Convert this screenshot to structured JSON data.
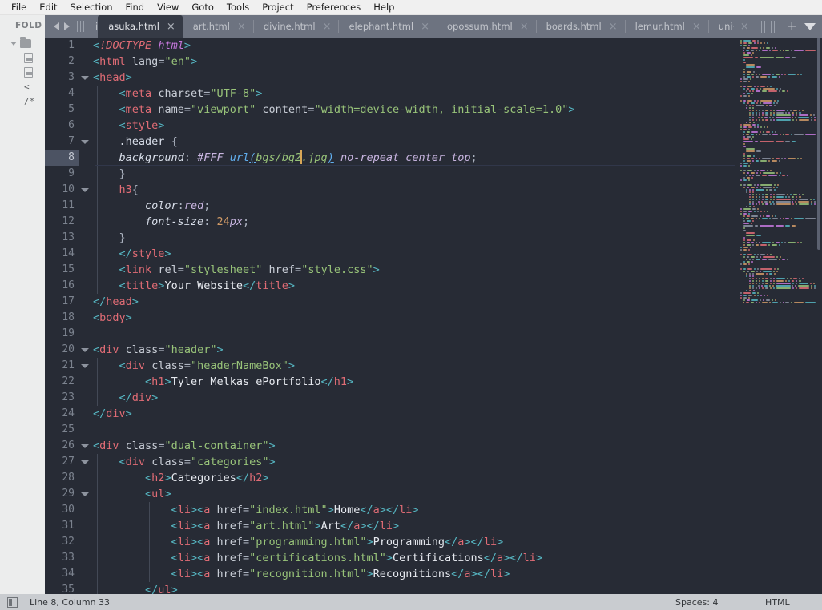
{
  "menu": {
    "items": [
      "File",
      "Edit",
      "Selection",
      "Find",
      "View",
      "Goto",
      "Tools",
      "Project",
      "Preferences",
      "Help"
    ]
  },
  "sidebar": {
    "title": "FOLD",
    "tree": [
      {
        "type": "folder",
        "label": ""
      },
      {
        "type": "file",
        "label": ""
      },
      {
        "type": "file",
        "label": ""
      },
      {
        "type": "text",
        "label": "<"
      },
      {
        "type": "text",
        "label": "/*"
      }
    ]
  },
  "tabbar": {
    "nav_prev": "◀",
    "nav_next": "▶",
    "close_glyph": "×",
    "new_tab": "+",
    "tabs": [
      {
        "label": "i",
        "active": false,
        "clipped": true
      },
      {
        "label": "asuka.html",
        "active": true,
        "clipped": false
      },
      {
        "label": "art.html",
        "active": false,
        "clipped": false
      },
      {
        "label": "divine.html",
        "active": false,
        "clipped": false
      },
      {
        "label": "elephant.html",
        "active": false,
        "clipped": false
      },
      {
        "label": "opossum.html",
        "active": false,
        "clipped": false
      },
      {
        "label": "boards.html",
        "active": false,
        "clipped": false
      },
      {
        "label": "lemur.html",
        "active": false,
        "clipped": false
      },
      {
        "label": "unitone.html",
        "active": false,
        "clipped": false
      }
    ]
  },
  "editor": {
    "active_line": 8,
    "lines": [
      {
        "n": 1,
        "fold": false,
        "indent": 0
      },
      {
        "n": 2,
        "fold": false,
        "indent": 0
      },
      {
        "n": 3,
        "fold": true,
        "indent": 0
      },
      {
        "n": 4,
        "fold": false,
        "indent": 1
      },
      {
        "n": 5,
        "fold": false,
        "indent": 1
      },
      {
        "n": 6,
        "fold": false,
        "indent": 1
      },
      {
        "n": 7,
        "fold": true,
        "indent": 1
      },
      {
        "n": 8,
        "fold": false,
        "indent": 1
      },
      {
        "n": 9,
        "fold": false,
        "indent": 1
      },
      {
        "n": 10,
        "fold": true,
        "indent": 1
      },
      {
        "n": 11,
        "fold": false,
        "indent": 2
      },
      {
        "n": 12,
        "fold": false,
        "indent": 2
      },
      {
        "n": 13,
        "fold": false,
        "indent": 1
      },
      {
        "n": 14,
        "fold": false,
        "indent": 1
      },
      {
        "n": 15,
        "fold": false,
        "indent": 1
      },
      {
        "n": 16,
        "fold": false,
        "indent": 1
      },
      {
        "n": 17,
        "fold": false,
        "indent": 0
      },
      {
        "n": 18,
        "fold": false,
        "indent": 0
      },
      {
        "n": 19,
        "fold": false,
        "indent": 0
      },
      {
        "n": 20,
        "fold": true,
        "indent": 0
      },
      {
        "n": 21,
        "fold": true,
        "indent": 1
      },
      {
        "n": 22,
        "fold": false,
        "indent": 2
      },
      {
        "n": 23,
        "fold": false,
        "indent": 1
      },
      {
        "n": 24,
        "fold": false,
        "indent": 0
      },
      {
        "n": 25,
        "fold": false,
        "indent": 0
      },
      {
        "n": 26,
        "fold": true,
        "indent": 0
      },
      {
        "n": 27,
        "fold": true,
        "indent": 1
      },
      {
        "n": 28,
        "fold": false,
        "indent": 2
      },
      {
        "n": 29,
        "fold": true,
        "indent": 2
      },
      {
        "n": 30,
        "fold": false,
        "indent": 3
      },
      {
        "n": 31,
        "fold": false,
        "indent": 3
      },
      {
        "n": 32,
        "fold": false,
        "indent": 3
      },
      {
        "n": 33,
        "fold": false,
        "indent": 3
      },
      {
        "n": 34,
        "fold": false,
        "indent": 3
      },
      {
        "n": 35,
        "fold": false,
        "indent": 2
      }
    ],
    "source_text": [
      "<!DOCTYPE html>",
      "<html lang=\"en\">",
      "<head>",
      "    <meta charset=\"UTF-8\">",
      "    <meta name=\"viewport\" content=\"width=device-width, initial-scale=1.0\">",
      "    <style>",
      "    .header {",
      "    background: #FFF url(bgs/bg2.jpg) no-repeat center top;",
      "    }",
      "    h3{",
      "        color:red;",
      "        font-size: 24px;",
      "    }",
      "    </style>",
      "    <link rel=\"stylesheet\" href=\"style.css\">",
      "    <title>Your Website</title>",
      "</head>",
      "<body>",
      "",
      "<div class=\"header\">",
      "    <div class=\"headerNameBox\">",
      "        <h1>Tyler Melkas ePortfolio</h1>",
      "    </div>",
      "</div>",
      "",
      "<div class=\"dual-container\">",
      "    <div class=\"categories\">",
      "        <h2>Categories</h2>",
      "        <ul>",
      "            <li><a href=\"index.html\">Home</a></li>",
      "            <li><a href=\"art.html\">Art</a></li>",
      "            <li><a href=\"programming.html\">Programming</a></li>",
      "            <li><a href=\"certifications.html\">Certifications</a></li>",
      "            <li><a href=\"recognition.html\">Recognitions</a></li>",
      "        </ul>"
    ]
  },
  "statusbar": {
    "position": "Line 8, Column 33",
    "spaces": "Spaces: 4",
    "syntax": "HTML"
  },
  "colors": {
    "editor_bg": "#272b35",
    "tabbar_bg": "#6d7380",
    "active_tab_bg": "#353a45",
    "menubar_bg": "#f0f0f0",
    "sidebar_bg": "#eceded",
    "statusbar_bg": "#c9ccd0",
    "tag": "#e06c75",
    "string": "#98c379",
    "attribute": "#d19a66",
    "angle": "#56b6c2",
    "caret": "#d8a657",
    "highlight_gutter": "#4c5363"
  }
}
